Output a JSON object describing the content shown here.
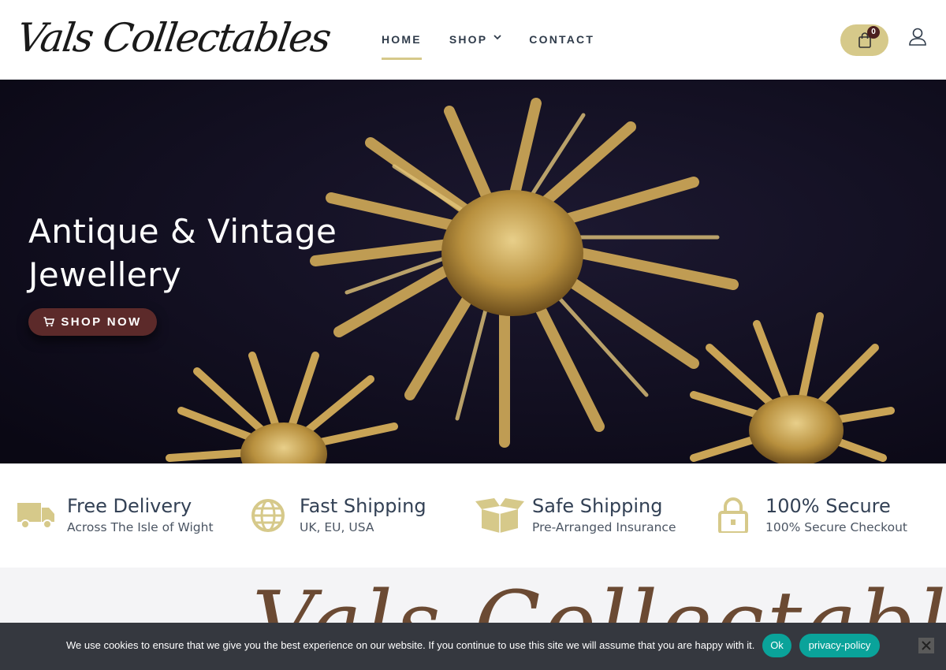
{
  "header": {
    "logo_text": "Vals Collectables",
    "nav": [
      {
        "label": "HOME"
      },
      {
        "label": "SHOP"
      },
      {
        "label": "CONTACT"
      }
    ],
    "cart_count": "0"
  },
  "hero": {
    "title_line1": "Antique & Vintage",
    "title_line2": "Jewellery",
    "cta": "SHOP NOW"
  },
  "features": [
    {
      "icon": "truck-icon",
      "title": "Free Delivery",
      "subtitle": "Across The Isle of Wight"
    },
    {
      "icon": "globe-icon",
      "title": "Fast Shipping",
      "subtitle": "UK, EU, USA"
    },
    {
      "icon": "box-icon",
      "title": "Safe Shipping",
      "subtitle": "Pre-Arranged Insurance"
    },
    {
      "icon": "lock-icon",
      "title": "100% Secure",
      "subtitle": "100% Secure Checkout"
    }
  ],
  "lower": {
    "script_heading": "Vals Collectables"
  },
  "cookie": {
    "text": "We use cookies to ensure that we give you the best experience on our website. If you continue to use this site we will assume that you are happy with it.",
    "ok_label": "Ok",
    "privacy_label": "privacy-policy"
  },
  "colors": {
    "accent_gold": "#d6c98a",
    "button_maroon": "#5c2a2a",
    "cookie_bg": "#35383f",
    "cookie_button": "#0aa39a",
    "script_brown": "#6b4a33"
  }
}
